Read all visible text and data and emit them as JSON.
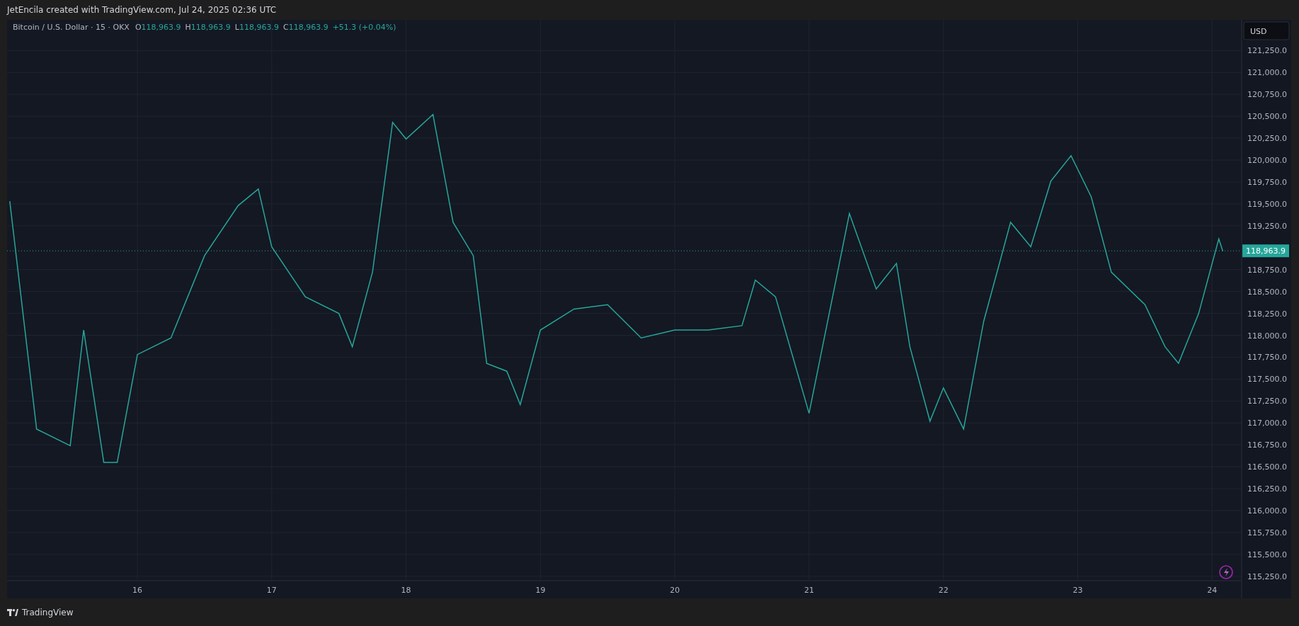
{
  "header": {
    "text": "JetEncila created with TradingView.com, Jul 24, 2025 02:36 UTC"
  },
  "legend": {
    "symbol": "Bitcoin / U.S. Dollar · 15 · OKX",
    "fields": [
      {
        "label": "O",
        "value": "118,963.9"
      },
      {
        "label": "H",
        "value": "118,963.9"
      },
      {
        "label": "L",
        "value": "118,963.9"
      },
      {
        "label": "C",
        "value": "118,963.9"
      }
    ],
    "change": "+51.3 (+0.04%)"
  },
  "chart": {
    "currency_button": "USD",
    "chart_data": {
      "type": "line",
      "grid": true,
      "ref_lines": [
        {
          "axis": "y",
          "value": 118963.9,
          "label": "118,963.9",
          "color": "#26a69a"
        }
      ],
      "x": [
        15.05,
        15.25,
        15.5,
        15.6,
        15.75,
        15.85,
        16.0,
        16.25,
        16.5,
        16.75,
        16.9,
        17.0,
        17.25,
        17.5,
        17.6,
        17.75,
        17.9,
        18.0,
        18.2,
        18.35,
        18.5,
        18.6,
        18.75,
        18.85,
        19.0,
        19.25,
        19.5,
        19.75,
        20.0,
        20.25,
        20.5,
        20.6,
        20.75,
        21.0,
        21.1,
        21.3,
        21.5,
        21.65,
        21.75,
        21.9,
        22.0,
        22.15,
        22.3,
        22.5,
        22.65,
        22.8,
        22.95,
        23.1,
        23.25,
        23.5,
        23.65,
        23.75,
        23.9,
        24.0,
        24.05,
        24.08
      ],
      "series": [
        {
          "color": "#26a69a",
          "values": [
            119530,
            116930,
            116740,
            118060,
            116550,
            116550,
            117780,
            117970,
            118910,
            119480,
            119670,
            119010,
            118440,
            118250,
            117870,
            118720,
            120430,
            120240,
            120520,
            119290,
            118910,
            117680,
            117590,
            117210,
            118060,
            118300,
            118350,
            117970,
            118060,
            118060,
            118110,
            118630,
            118440,
            117110,
            117870,
            119390,
            118530,
            118820,
            117870,
            117020,
            117400,
            116930,
            118160,
            119290,
            119010,
            119760,
            120050,
            119580,
            118720,
            118350,
            117870,
            117680,
            118250,
            118820,
            119100,
            118960
          ]
        }
      ],
      "xlim": [
        15.03,
        24.22
      ],
      "ylim": [
        115200,
        121600
      ],
      "xticks": [
        16,
        17,
        18,
        19,
        20,
        21,
        22,
        23,
        24
      ],
      "yticks": [
        {
          "value": 115250,
          "label": "115,250.0"
        },
        {
          "value": 115500,
          "label": "115,500.0"
        },
        {
          "value": 115750,
          "label": "115,750.0"
        },
        {
          "value": 116000,
          "label": "116,000.0"
        },
        {
          "value": 116250,
          "label": "116,250.0"
        },
        {
          "value": 116500,
          "label": "116,500.0"
        },
        {
          "value": 116750,
          "label": "116,750.0"
        },
        {
          "value": 117000,
          "label": "117,000.0"
        },
        {
          "value": 117250,
          "label": "117,250.0"
        },
        {
          "value": 117500,
          "label": "117,500.0"
        },
        {
          "value": 117750,
          "label": "117,750.0"
        },
        {
          "value": 118000,
          "label": "118,000.0"
        },
        {
          "value": 118250,
          "label": "118,250.0"
        },
        {
          "value": 118500,
          "label": "118,500.0"
        },
        {
          "value": 118750,
          "label": "118,750.0"
        },
        {
          "value": 119250,
          "label": "119,250.0"
        },
        {
          "value": 119500,
          "label": "119,500.0"
        },
        {
          "value": 119750,
          "label": "119,750.0"
        },
        {
          "value": 120000,
          "label": "120,000.0"
        },
        {
          "value": 120250,
          "label": "120,250.0"
        },
        {
          "value": 120500,
          "label": "120,500.0"
        },
        {
          "value": 120750,
          "label": "120,750.0"
        },
        {
          "value": 121000,
          "label": "121,000.0"
        },
        {
          "value": 121250,
          "label": "121,250.0"
        }
      ]
    }
  },
  "footer": {
    "logo_text": "TradingView"
  }
}
